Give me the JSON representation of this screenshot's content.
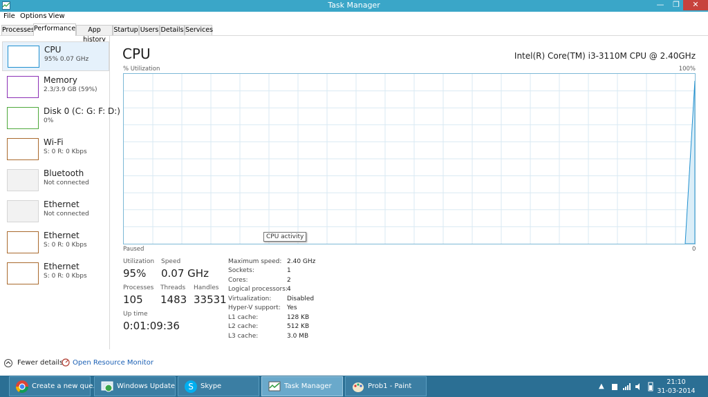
{
  "window": {
    "title": "Task Manager",
    "controls": {
      "minimize": "—",
      "maximize": "❐",
      "close": "✕"
    }
  },
  "menu": [
    "File",
    "Options",
    "View"
  ],
  "tabs": [
    "Processes",
    "Performance",
    "App history",
    "Startup",
    "Users",
    "Details",
    "Services"
  ],
  "active_tab": "Performance",
  "sidebar": [
    {
      "name": "CPU",
      "sub": "95%  0.07 GHz",
      "color": "#1f8fcf",
      "selected": true
    },
    {
      "name": "Memory",
      "sub": "2.3/3.9 GB (59%)",
      "color": "#8b2fb5"
    },
    {
      "name": "Disk 0 (C: G: F: D:)",
      "sub": "0%",
      "color": "#4da83a"
    },
    {
      "name": "Wi-Fi",
      "sub": "S: 0  R: 0 Kbps",
      "color": "#a9692c"
    },
    {
      "name": "Bluetooth",
      "sub": "Not connected",
      "color": "#cfcfcf"
    },
    {
      "name": "Ethernet",
      "sub": "Not connected",
      "color": "#cfcfcf"
    },
    {
      "name": "Ethernet",
      "sub": "S: 0  R: 0 Kbps",
      "color": "#a9692c"
    },
    {
      "name": "Ethernet",
      "sub": "S: 0  R: 0 Kbps",
      "color": "#a9692c"
    }
  ],
  "main": {
    "title": "CPU",
    "model": "Intel(R) Core(TM) i3-3110M CPU @ 2.40GHz",
    "graph": {
      "y_label": "% Utilization",
      "y_max_label": "100%",
      "status": "Paused",
      "x_min_label": "0",
      "tooltip": "CPU activity",
      "color": "#1f8fcf"
    },
    "stats": {
      "utilization_label": "Utilization",
      "utilization": "95%",
      "speed_label": "Speed",
      "speed": "0.07 GHz",
      "processes_label": "Processes",
      "processes": "105",
      "threads_label": "Threads",
      "threads": "1483",
      "handles_label": "Handles",
      "handles": "33531",
      "uptime_label": "Up time",
      "uptime": "0:01:09:36"
    },
    "info": [
      {
        "key": "Maximum speed:",
        "value": "2.40 GHz"
      },
      {
        "key": "Sockets:",
        "value": "1"
      },
      {
        "key": "Cores:",
        "value": "2"
      },
      {
        "key": "Logical processors:",
        "value": "4"
      },
      {
        "key": "Virtualization:",
        "value": "Disabled"
      },
      {
        "key": "Hyper-V support:",
        "value": "Yes"
      },
      {
        "key": "L1 cache:",
        "value": "128 KB"
      },
      {
        "key": "L2 cache:",
        "value": "512 KB"
      },
      {
        "key": "L3 cache:",
        "value": "3.0 MB"
      }
    ]
  },
  "footer": {
    "fewer_details": "Fewer details",
    "resource_monitor": "Open Resource Monitor"
  },
  "taskbar": {
    "buttons": [
      {
        "label": "Create a new que...",
        "icon": "chrome-icon"
      },
      {
        "label": "Windows Update",
        "icon": "windows-update-icon"
      },
      {
        "label": "Skype",
        "icon": "skype-icon"
      },
      {
        "label": "Task Manager",
        "icon": "task-manager-icon",
        "active": true
      },
      {
        "label": "Prob1 - Paint",
        "icon": "paint-icon"
      }
    ],
    "time": "21:10",
    "date": "31-03-2014"
  }
}
